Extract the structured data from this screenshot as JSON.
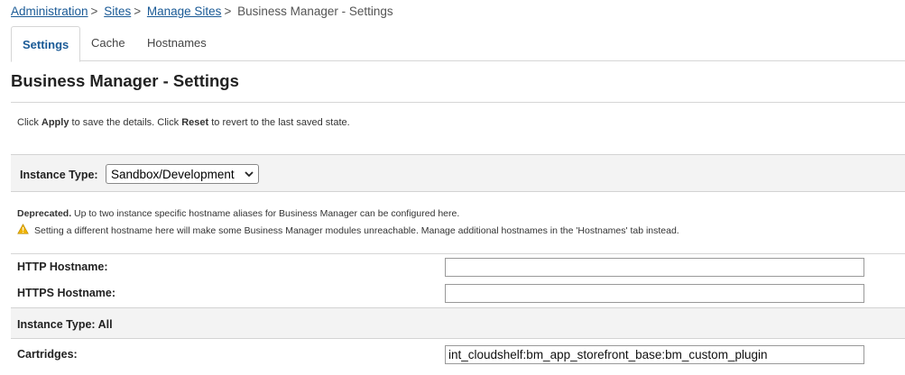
{
  "breadcrumb": {
    "items": [
      "Administration",
      "Sites",
      "Manage Sites"
    ],
    "current": "Business Manager - Settings",
    "separator": ">"
  },
  "tabs": [
    {
      "label": "Settings",
      "active": true
    },
    {
      "label": "Cache",
      "active": false
    },
    {
      "label": "Hostnames",
      "active": false
    }
  ],
  "page": {
    "title": "Business Manager - Settings",
    "intro": {
      "pre": "Click ",
      "apply": "Apply",
      "mid": " to save the details. Click ",
      "reset": "Reset",
      "post": " to revert to the last saved state."
    }
  },
  "instance_type": {
    "label": "Instance Type:",
    "selected": "Sandbox/Development"
  },
  "notice": {
    "deprecated": "Deprecated.",
    "text": " Up to two instance specific hostname aliases for Business Manager can be configured here.",
    "warning": "Setting a different hostname here will make some Business Manager modules unreachable. Manage additional hostnames in the 'Hostnames' tab instead.",
    "warning_icon": "warning-triangle-icon",
    "warning_color": "#f0b400"
  },
  "fields": {
    "http_label": "HTTP Hostname:",
    "http_value": "",
    "https_label": "HTTPS Hostname:",
    "https_value": ""
  },
  "instance_all": {
    "label": "Instance Type:",
    "value": "All"
  },
  "cartridges": {
    "label": "Cartridges:",
    "value": "int_cloudshelf:bm_app_storefront_base:bm_custom_plugin"
  },
  "colors": {
    "link": "#1a5a96",
    "section_bg": "#f3f3f3",
    "border": "#d6d6d6"
  }
}
